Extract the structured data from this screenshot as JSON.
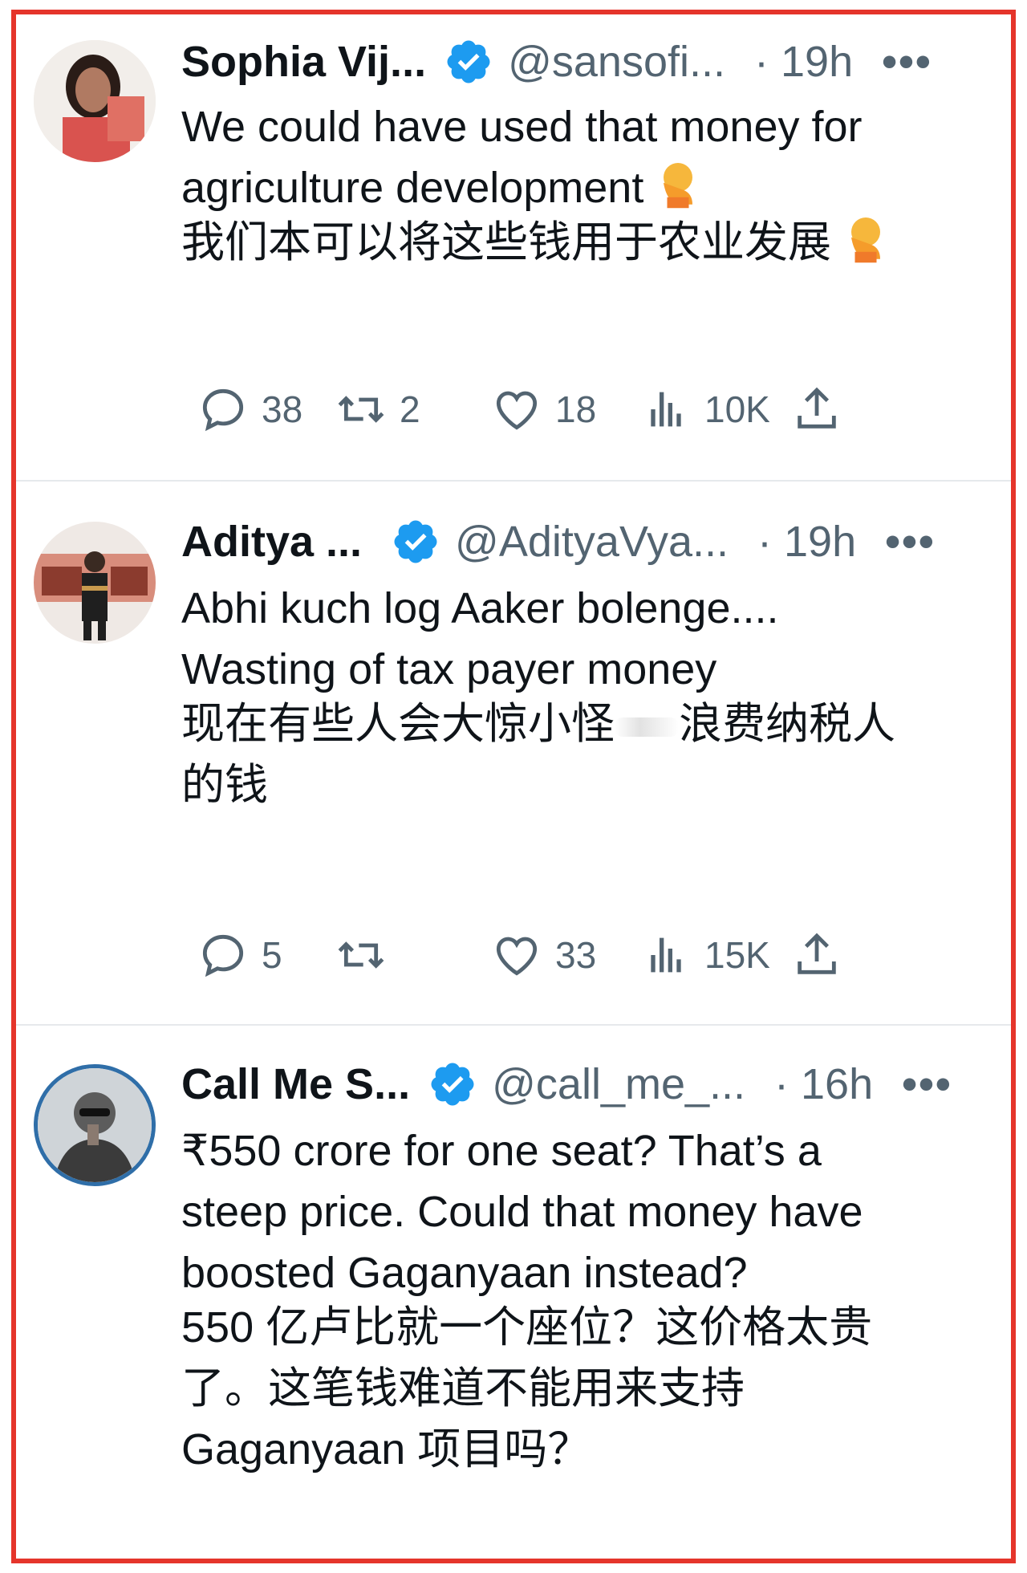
{
  "tweets": [
    {
      "name": "Sophia Vij...",
      "handle": "@sansofi...",
      "time": "· 19h",
      "more": "•••",
      "text_lines": [
        "We could have used that money for",
        "agriculture development"
      ],
      "translation_lines": [
        "我们本可以将这些钱用于农业发展"
      ],
      "emoji": "face-palm-emoji",
      "stats": {
        "replies": "38",
        "retweets": "2",
        "likes": "18",
        "views": "10K"
      }
    },
    {
      "name": "Aditya ...",
      "handle": "@AdityaVya...",
      "time": "· 19h",
      "more": "•••",
      "text_lines": [
        "Abhi kuch log Aaker bolenge....",
        "Wasting of tax payer money"
      ],
      "translation_parts": [
        "现在有些人会大惊小怪",
        "浪费纳税人"
      ],
      "translation_line2": "的钱",
      "stats": {
        "replies": "5",
        "retweets": "",
        "likes": "33",
        "views": "15K"
      }
    },
    {
      "name": "Call Me S...",
      "handle": "@call_me_...",
      "time": "· 16h",
      "more": "•••",
      "text_lines": [
        "₹550 crore for one seat? That’s a",
        "steep price. Could that money have",
        "boosted Gaganyaan instead?"
      ],
      "translation_lines": [
        "550 亿卢比就一个座位？这价格太贵",
        "了。这笔钱难道不能用来支持",
        "Gaganyaan 项目吗？"
      ]
    }
  ],
  "colors": {
    "frame": "#e5352b",
    "verified": "#1d9bf0",
    "muted": "#536471",
    "text": "#0f1419"
  },
  "icons": [
    "reply-icon",
    "retweet-icon",
    "like-icon",
    "views-icon",
    "share-icon",
    "verified-badge-icon"
  ]
}
